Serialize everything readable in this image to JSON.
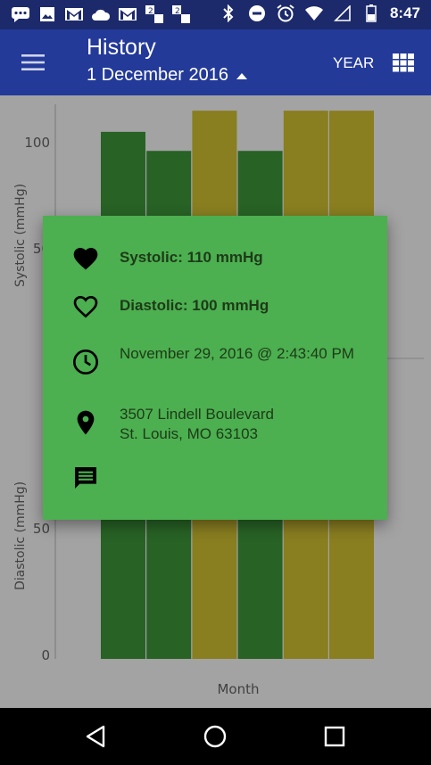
{
  "status_bar": {
    "time": "8:47",
    "left_icons": [
      "chat-icon",
      "image-icon",
      "gmail-icon",
      "cloud-icon",
      "gmail-icon",
      "game-2-icon",
      "game-2-icon"
    ],
    "right_icons": [
      "bluetooth-icon",
      "do-not-disturb-icon",
      "alarm-icon",
      "wifi-icon",
      "signal-icon",
      "battery-icon"
    ]
  },
  "app_bar": {
    "title": "History",
    "subtitle": "1 December 2016",
    "year_label": "YEAR"
  },
  "chart": {
    "x_label": "Month",
    "y_label_top": "Systolic (mmHg)",
    "y_label_bottom": "Diastolic (mmHg)",
    "top_ticks": [
      "100",
      "50"
    ],
    "bottom_ticks": [
      "50",
      "0"
    ]
  },
  "chart_data": [
    {
      "type": "bar",
      "ylabel": "Systolic (mmHg)",
      "xlabel": "Month",
      "ylim": [
        0,
        120
      ],
      "values": [
        107,
        98,
        117,
        98,
        117,
        117
      ],
      "colors": [
        "#3f9a3a",
        "#3f9a3a",
        "#d6c632",
        "#3f9a3a",
        "#d6c632",
        "#d6c632"
      ]
    },
    {
      "type": "bar",
      "ylabel": "Diastolic (mmHg)",
      "xlabel": "Month",
      "ylim": [
        0,
        60
      ],
      "values": [
        60,
        60,
        60,
        60,
        60,
        60
      ],
      "colors": [
        "#3f9a3a",
        "#3f9a3a",
        "#d6c632",
        "#3f9a3a",
        "#d6c632",
        "#d6c632"
      ]
    }
  ],
  "dialog": {
    "systolic": "Systolic: 110 mmHg",
    "diastolic": "Diastolic: 100 mmHg",
    "datetime": "November 29, 2016 @ 2:43:40 PM",
    "address_line1": "3507 Lindell Boulevard",
    "address_line2": "St. Louis, MO 63103"
  },
  "colors": {
    "app_bar": "#233a99",
    "status_bar": "#1c2a6b",
    "dialog_bg": "#4caf50",
    "bar_green": "#3f9a3a",
    "bar_yellow": "#d6c632"
  }
}
